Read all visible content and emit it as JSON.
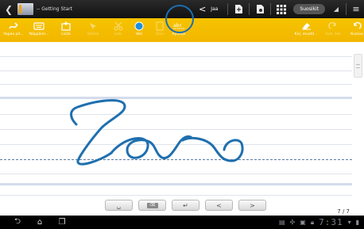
{
  "titlebar": {
    "title": "-- Getting Start",
    "share_label": "Jaa",
    "account_label": "Suosikit"
  },
  "toolbar": {
    "tools": [
      {
        "label": "Vapaa pit...",
        "icon": "hand-pen-icon",
        "dim": false
      },
      {
        "label": "Näppäim...",
        "icon": "keyboard-icon",
        "dim": false
      },
      {
        "label": "Lisää",
        "icon": "insert-icon",
        "dim": false
      },
      {
        "label": "Valitse",
        "icon": "select-icon",
        "dim": true
      },
      {
        "label": "Leik.",
        "icon": "cut-icon",
        "dim": true
      },
      {
        "label": "Väri",
        "icon": "color-icon",
        "dim": false
      },
      {
        "label": "Sivu",
        "icon": "page-icon",
        "dim": true
      },
      {
        "label": "Ajoohje",
        "icon": "baseline-icon",
        "dim": false
      },
      {
        "label": "Kirj. muotil...",
        "icon": "eraser-icon",
        "dim": false
      },
      {
        "label": "Uud. tee",
        "icon": "redo-icon",
        "dim": true
      },
      {
        "label": "Kumoa",
        "icon": "undo-icon",
        "dim": false
      }
    ],
    "color_swatch": "#1a8fe0",
    "bar_color": "#f2b700"
  },
  "page": {
    "page_indicator": "7 / 7",
    "ink_color": "#1f6fae"
  },
  "keybar": {
    "space_label": "␣",
    "backspace_label": "⌫",
    "enter_label": "↵",
    "prev_label": "<",
    "next_label": ">"
  },
  "navbar": {
    "clock": "7:31"
  }
}
